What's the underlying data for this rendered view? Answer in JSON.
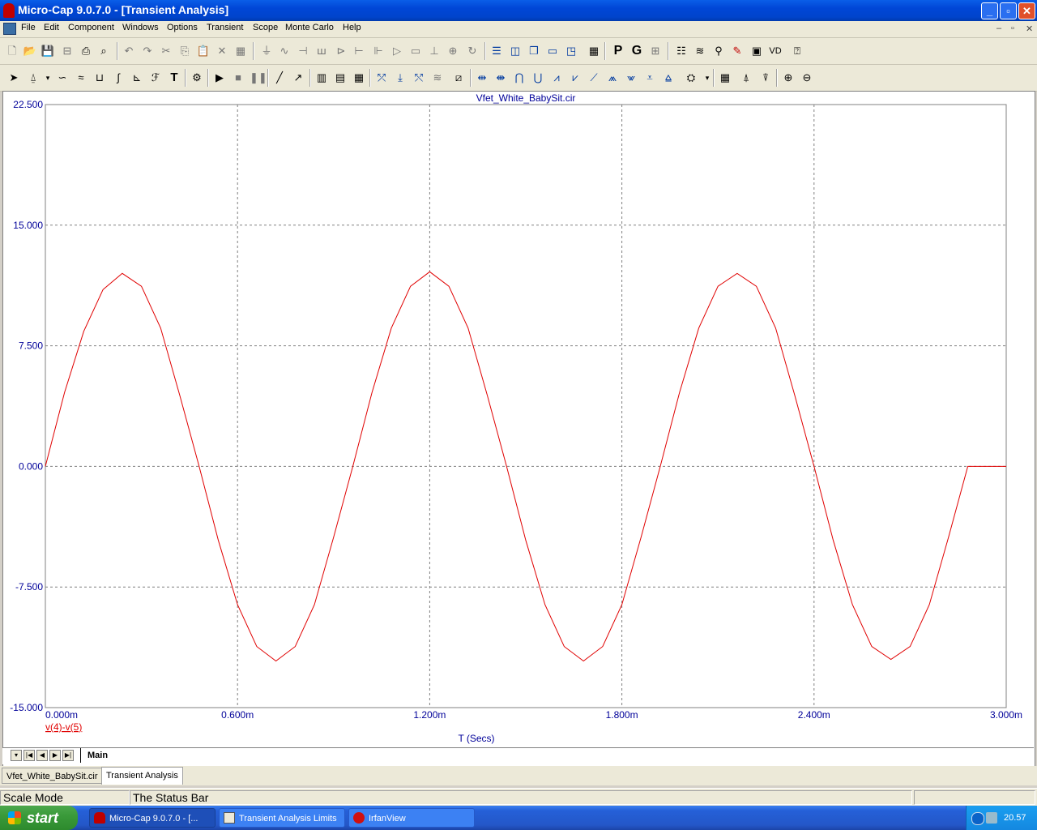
{
  "window": {
    "title": "Micro-Cap 9.0.7.0 - [Transient Analysis]",
    "controls": [
      "_",
      "▫",
      "✕"
    ]
  },
  "menu": {
    "items": [
      "File",
      "Edit",
      "Component",
      "Windows",
      "Options",
      "Transient",
      "Scope",
      "Monte Carlo",
      "Help"
    ],
    "mdi_controls": [
      "–",
      "▫",
      "✕"
    ]
  },
  "plot": {
    "title": "Vfet_White_BabySit.cir",
    "xlabel": "T (Secs)",
    "legend": "v(4)-v(5)",
    "trace_color": "#e00000",
    "axis_text_color": "#000099"
  },
  "chart_data": {
    "type": "line",
    "title": "Vfet_White_BabySit.cir",
    "xlabel": "T (Secs)",
    "ylabel": "",
    "xlim": [
      0,
      3.0
    ],
    "ylim": [
      -15,
      22.5
    ],
    "x_unit": "ms",
    "x_ticks": [
      0,
      0.6,
      1.2,
      1.8,
      2.4,
      3.0
    ],
    "x_tick_labels": [
      "0.000m",
      "0.600m",
      "1.200m",
      "1.800m",
      "2.400m",
      "3.000m"
    ],
    "y_ticks": [
      22.5,
      15,
      7.5,
      0,
      -7.5,
      -15
    ],
    "y_tick_labels": [
      "22.500",
      "15.000",
      "7.500",
      "0.000",
      "-7.500",
      "-15.000"
    ],
    "grid": true,
    "legend_position": "bottom-left",
    "series": [
      {
        "name": "v(4)-v(5)",
        "x": [
          0,
          0.06,
          0.12,
          0.18,
          0.24,
          0.3,
          0.36,
          0.42,
          0.48,
          0.54,
          0.6,
          0.66,
          0.72,
          0.78,
          0.84,
          0.9,
          0.96,
          1.02,
          1.08,
          1.14,
          1.2,
          1.26,
          1.32,
          1.38,
          1.44,
          1.5,
          1.56,
          1.62,
          1.68,
          1.74,
          1.8,
          1.86,
          1.92,
          1.98,
          2.04,
          2.1,
          2.16,
          2.22,
          2.28,
          2.34,
          2.4,
          2.46,
          2.52,
          2.58,
          2.64,
          2.7,
          2.76,
          2.82,
          2.88,
          2.94,
          3.0
        ],
        "y": [
          0,
          4.6,
          8.4,
          11.0,
          12.0,
          11.2,
          8.6,
          4.4,
          0,
          -4.6,
          -8.6,
          -11.2,
          -12.1,
          -11.2,
          -8.6,
          -4.4,
          0,
          4.6,
          8.6,
          11.2,
          12.1,
          11.2,
          8.6,
          4.4,
          0,
          -4.6,
          -8.6,
          -11.2,
          -12.1,
          -11.2,
          -8.6,
          -4.4,
          0,
          4.6,
          8.6,
          11.2,
          12.0,
          11.2,
          8.6,
          4.4,
          0,
          -4.6,
          -8.6,
          -11.2,
          -12.0,
          -11.2,
          -8.6,
          -4.4,
          0,
          0,
          0
        ]
      }
    ]
  },
  "tabs": {
    "plot_tab": "Main",
    "documents": [
      "Vfet_White_BabySit.cir",
      "Transient Analysis"
    ]
  },
  "status": {
    "mode": "Scale Mode",
    "message": "The Status Bar"
  },
  "taskbar": {
    "start_label": "start",
    "tasks": [
      "Micro-Cap 9.0.7.0 - [...",
      "Transient Analysis Limits",
      "IrfanView"
    ],
    "clock": "20.57"
  }
}
